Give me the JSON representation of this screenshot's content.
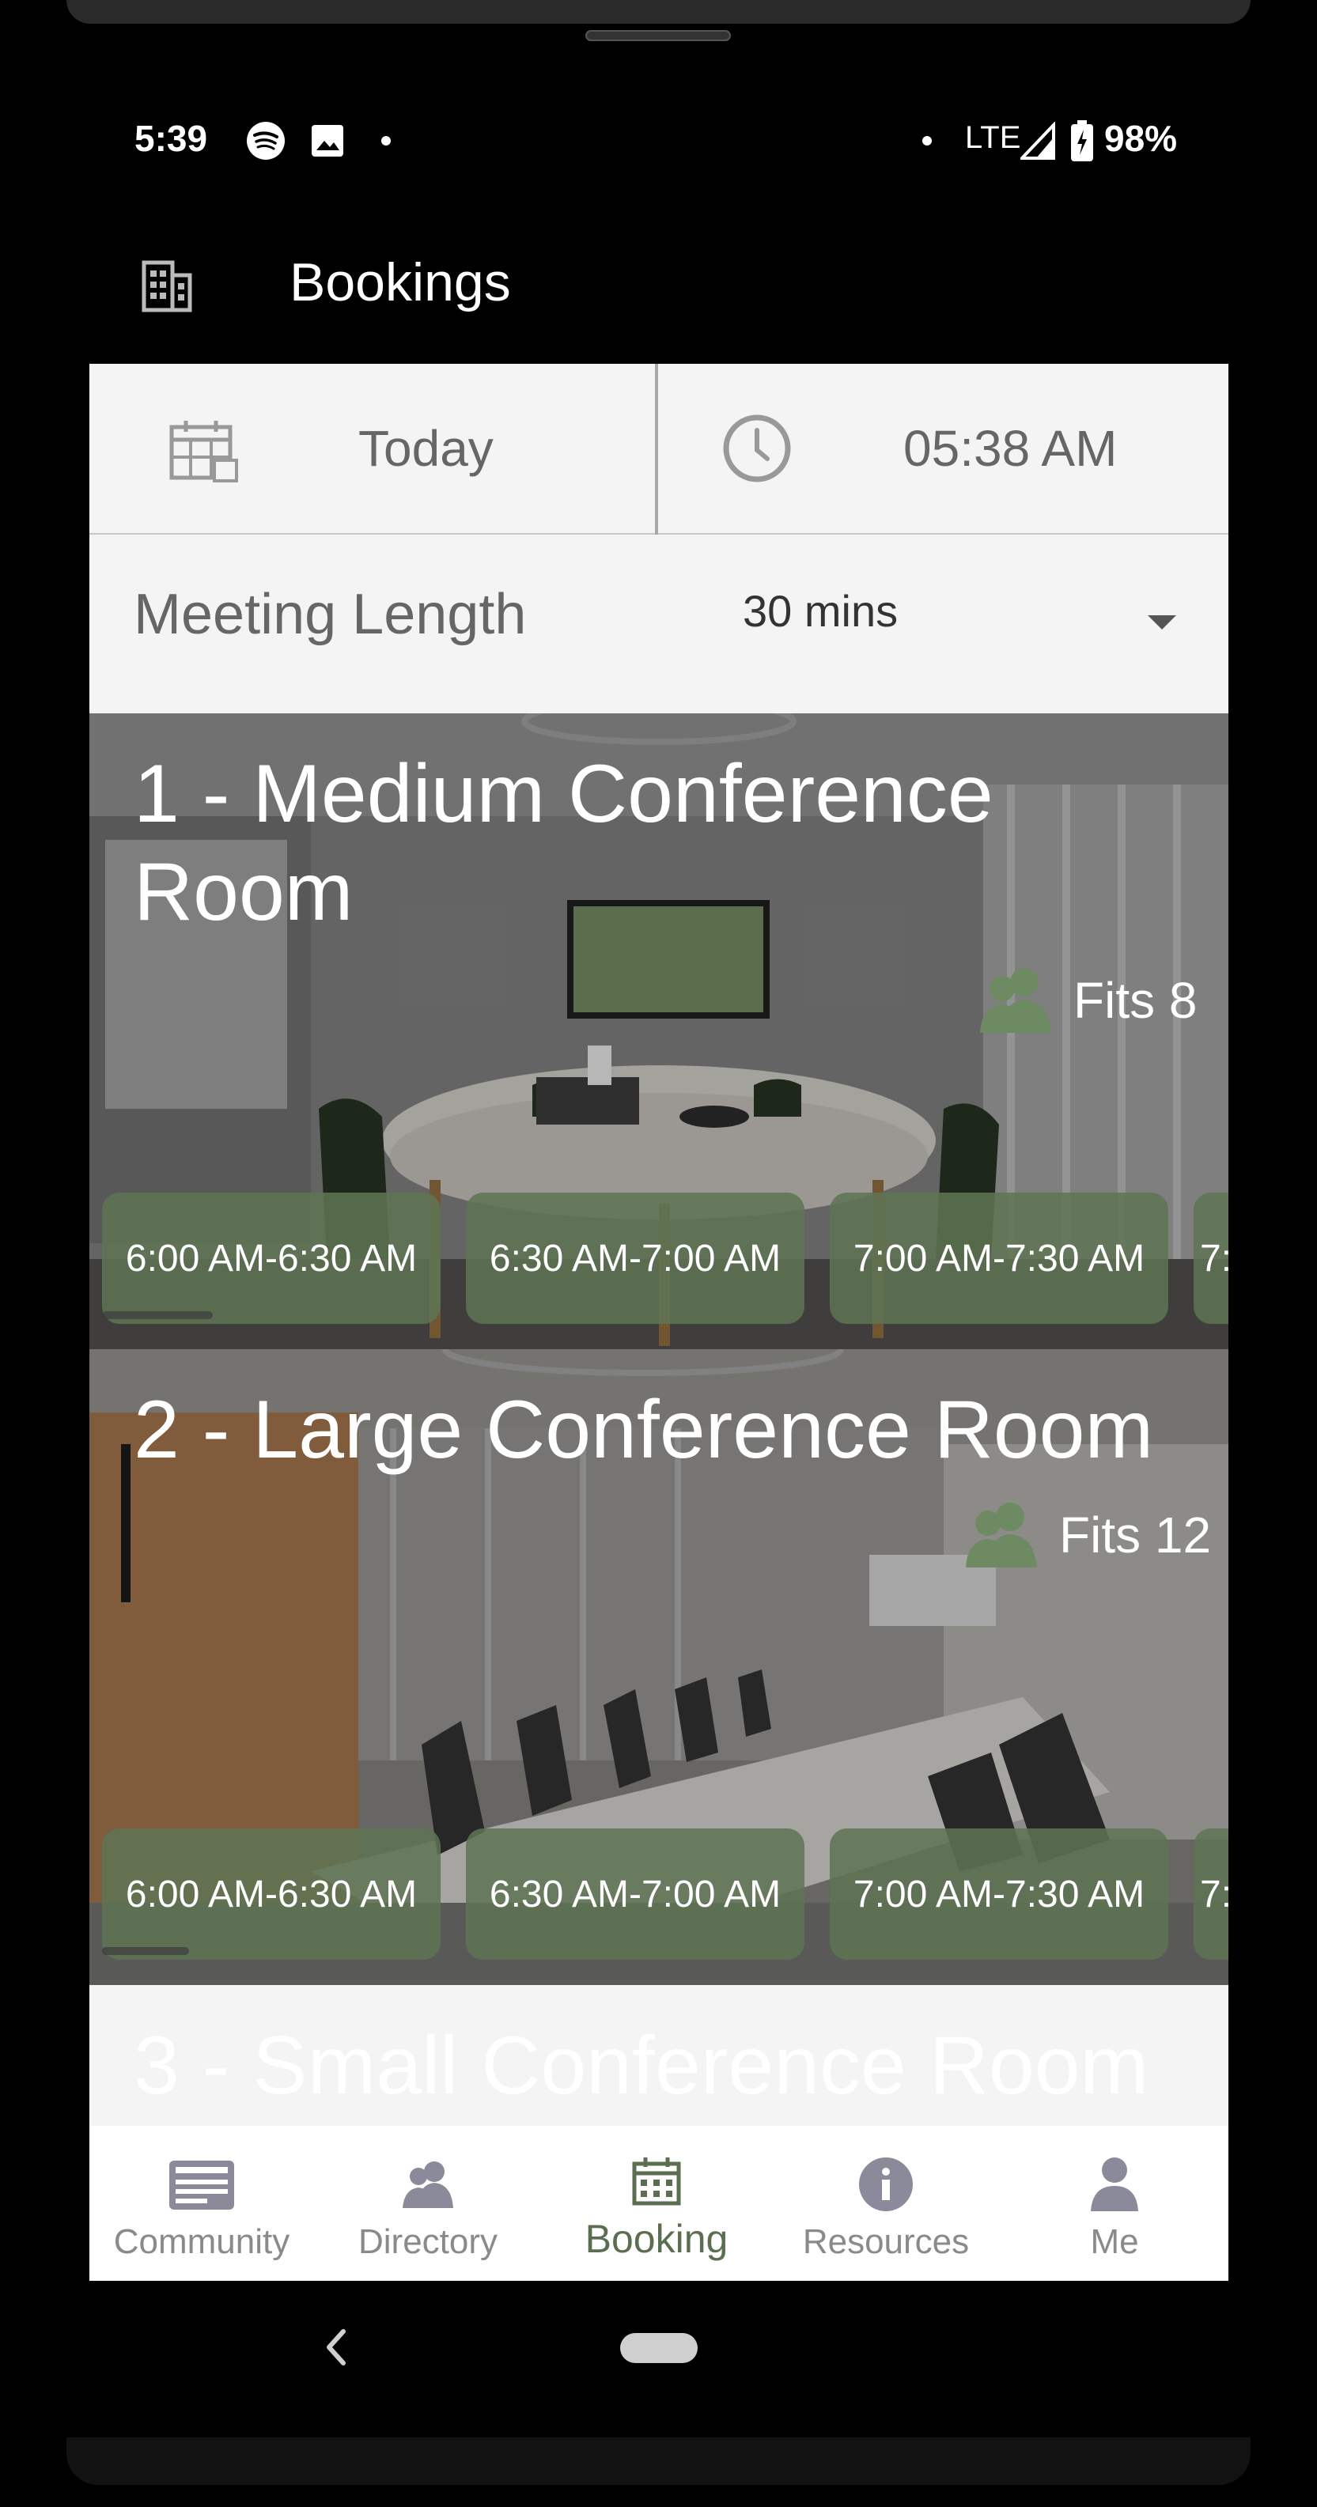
{
  "status_bar": {
    "time": "5:39",
    "network": "LTE",
    "battery": "98%",
    "icons": [
      "spotify-icon",
      "image-icon",
      "dot-icon",
      "dot-icon",
      "signal-icon",
      "battery-icon"
    ]
  },
  "app_bar": {
    "title": "Bookings",
    "icon": "building-icon"
  },
  "date_picker": {
    "value": "Today",
    "icon": "calendar-icon"
  },
  "time_picker": {
    "value": "05:38 AM",
    "icon": "clock-icon"
  },
  "meeting_length": {
    "label": "Meeting Length",
    "value": "30 mins",
    "icon": "dropdown-arrow-icon"
  },
  "rooms": [
    {
      "name_line1": "1 - Medium Conference",
      "name_line2": "Room",
      "capacity": "Fits 8",
      "slots": [
        "6:00 AM-6:30 AM",
        "6:30 AM-7:00 AM",
        "7:00 AM-7:30 AM",
        "7:"
      ]
    },
    {
      "name": "2 - Large Conference Room",
      "capacity": "Fits 12",
      "slots": [
        "6:00 AM-6:30 AM",
        "6:30 AM-7:00 AM",
        "7:00 AM-7:30 AM",
        "7:"
      ]
    },
    {
      "name": "3 - Small Conference Room"
    }
  ],
  "bottom_nav": {
    "items": [
      {
        "label": "Community",
        "icon": "community-icon"
      },
      {
        "label": "Directory",
        "icon": "directory-icon"
      },
      {
        "label": "Booking",
        "icon": "booking-icon",
        "active": true
      },
      {
        "label": "Resources",
        "icon": "info-icon"
      },
      {
        "label": "Me",
        "icon": "person-icon"
      }
    ]
  },
  "colors": {
    "accent": "#5c6e52",
    "slot_bg": "#5e7454",
    "panel_bg": "#f4f4f4",
    "inactive": "#8a8a8a"
  }
}
